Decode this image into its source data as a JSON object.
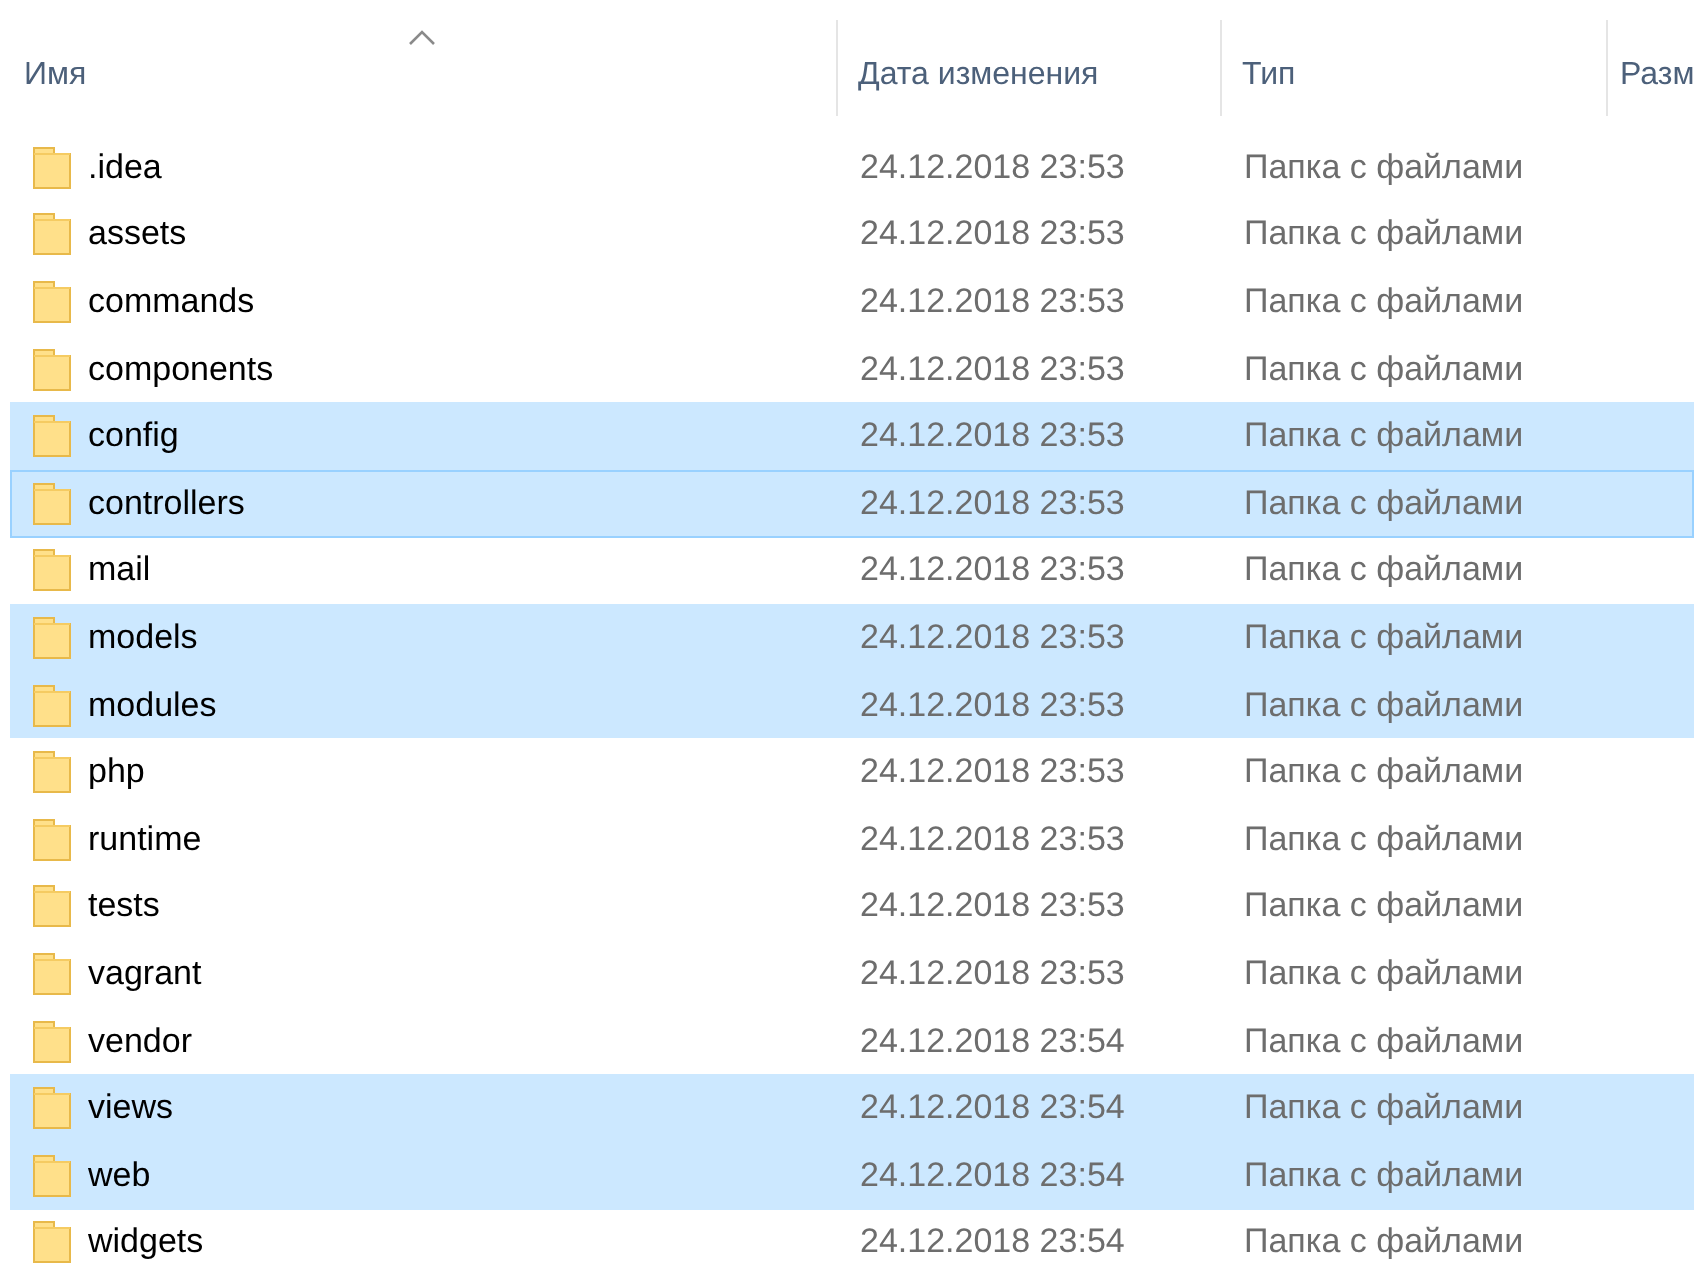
{
  "columns": [
    {
      "label": "Имя",
      "sorted": true
    },
    {
      "label": "Дата изменения",
      "sorted": false
    },
    {
      "label": "Тип",
      "sorted": false
    },
    {
      "label": "Разм",
      "sorted": false
    }
  ],
  "rows": [
    {
      "name": ".idea",
      "date": "24.12.2018 23:53",
      "type": "Папка с файлами",
      "selected": false,
      "focused": false
    },
    {
      "name": "assets",
      "date": "24.12.2018 23:53",
      "type": "Папка с файлами",
      "selected": false,
      "focused": false
    },
    {
      "name": "commands",
      "date": "24.12.2018 23:53",
      "type": "Папка с файлами",
      "selected": false,
      "focused": false
    },
    {
      "name": "components",
      "date": "24.12.2018 23:53",
      "type": "Папка с файлами",
      "selected": false,
      "focused": false
    },
    {
      "name": "config",
      "date": "24.12.2018 23:53",
      "type": "Папка с файлами",
      "selected": true,
      "focused": false
    },
    {
      "name": "controllers",
      "date": "24.12.2018 23:53",
      "type": "Папка с файлами",
      "selected": true,
      "focused": true
    },
    {
      "name": "mail",
      "date": "24.12.2018 23:53",
      "type": "Папка с файлами",
      "selected": false,
      "focused": false
    },
    {
      "name": "models",
      "date": "24.12.2018 23:53",
      "type": "Папка с файлами",
      "selected": true,
      "focused": false
    },
    {
      "name": "modules",
      "date": "24.12.2018 23:53",
      "type": "Папка с файлами",
      "selected": true,
      "focused": false
    },
    {
      "name": "php",
      "date": "24.12.2018 23:53",
      "type": "Папка с файлами",
      "selected": false,
      "focused": false
    },
    {
      "name": "runtime",
      "date": "24.12.2018 23:53",
      "type": "Папка с файлами",
      "selected": false,
      "focused": false
    },
    {
      "name": "tests",
      "date": "24.12.2018 23:53",
      "type": "Папка с файлами",
      "selected": false,
      "focused": false
    },
    {
      "name": "vagrant",
      "date": "24.12.2018 23:53",
      "type": "Папка с файлами",
      "selected": false,
      "focused": false
    },
    {
      "name": "vendor",
      "date": "24.12.2018 23:54",
      "type": "Папка с файлами",
      "selected": false,
      "focused": false
    },
    {
      "name": "views",
      "date": "24.12.2018 23:54",
      "type": "Папка с файлами",
      "selected": true,
      "focused": false
    },
    {
      "name": "web",
      "date": "24.12.2018 23:54",
      "type": "Папка с файлами",
      "selected": true,
      "focused": false
    },
    {
      "name": "widgets",
      "date": "24.12.2018 23:54",
      "type": "Папка с файлами",
      "selected": false,
      "focused": false
    }
  ]
}
